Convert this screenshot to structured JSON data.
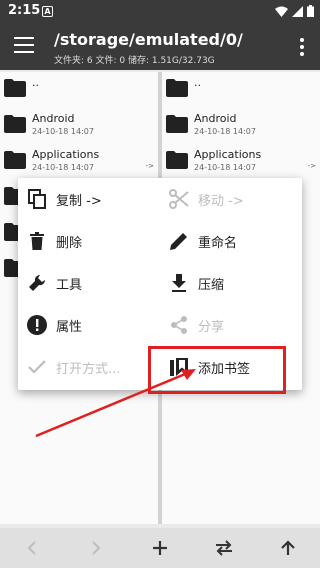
{
  "status": {
    "time": "2:15",
    "notif_glyph": "A"
  },
  "toolbar": {
    "path": "/storage/emulated/0/",
    "info": "文件夹: 6  文件: 0  储存: 1.51G/32.73G"
  },
  "left_pane": {
    "items": [
      {
        "name": "..",
        "date": ""
      },
      {
        "name": "Android",
        "date": "24-10-18 14:07"
      },
      {
        "name": "Applications",
        "date": "24-10-18 14:07",
        "arrow": "->"
      }
    ]
  },
  "right_pane": {
    "items": [
      {
        "name": "..",
        "date": ""
      },
      {
        "name": "Android",
        "date": "24-10-18 14:07"
      },
      {
        "name": "Applications",
        "date": "24-10-18 14:07",
        "arrow": "->"
      }
    ]
  },
  "context_menu": {
    "copy": "复制 ->",
    "move": "移动 ->",
    "delete": "删除",
    "rename": "重命名",
    "tools": "工具",
    "compress": "压缩",
    "properties": "属性",
    "share": "分享",
    "open_with": "打开方式...",
    "add_bookmark": "添加书签"
  },
  "colors": {
    "toolbar": "#3a3a3a",
    "highlight": "#e02020",
    "disabled": "#bdbdbd"
  },
  "icons": [
    "menu-icon",
    "more-icon",
    "folder-icon",
    "copy-icon",
    "scissors-icon",
    "trash-icon",
    "pencil-icon",
    "wrench-icon",
    "download-icon",
    "info-icon",
    "share-icon",
    "check-icon",
    "bookmark-icon",
    "back-icon",
    "forward-icon",
    "add-icon",
    "swap-icon",
    "up-icon"
  ]
}
